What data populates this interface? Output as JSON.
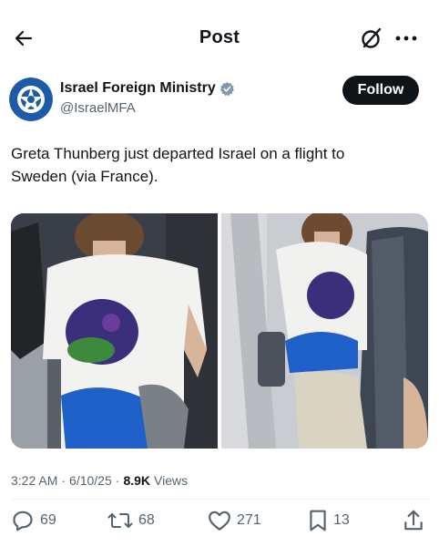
{
  "header": {
    "title": "Post"
  },
  "post": {
    "author": {
      "name": "Israel Foreign Ministry",
      "handle": "@IsraelMFA"
    },
    "follow_label": "Follow",
    "text_line1": "Greta Thunberg just departed Israel on a flight to",
    "text_line2": "Sweden (via France).",
    "time": "3:22 AM",
    "separator1": "·",
    "date": "6/10/25",
    "separator2": "·",
    "views_count": "8.9K",
    "views_label": "Views"
  },
  "actions": {
    "replies": "69",
    "reposts": "68",
    "likes": "271",
    "bookmarks": "13"
  },
  "colors": {
    "text": "#0f1419",
    "secondary": "#536471",
    "verified": "#829aab",
    "follow_bg": "#0f1419",
    "avatar_blue": "#1d5ba8"
  },
  "icons": {
    "back": "arrow-left-icon",
    "grok": "grok-icon",
    "more": "more-icon",
    "verified": "verified-badge-icon",
    "reply": "reply-icon",
    "repost": "repost-icon",
    "like": "heart-icon",
    "bookmark": "bookmark-icon",
    "share": "share-icon"
  }
}
